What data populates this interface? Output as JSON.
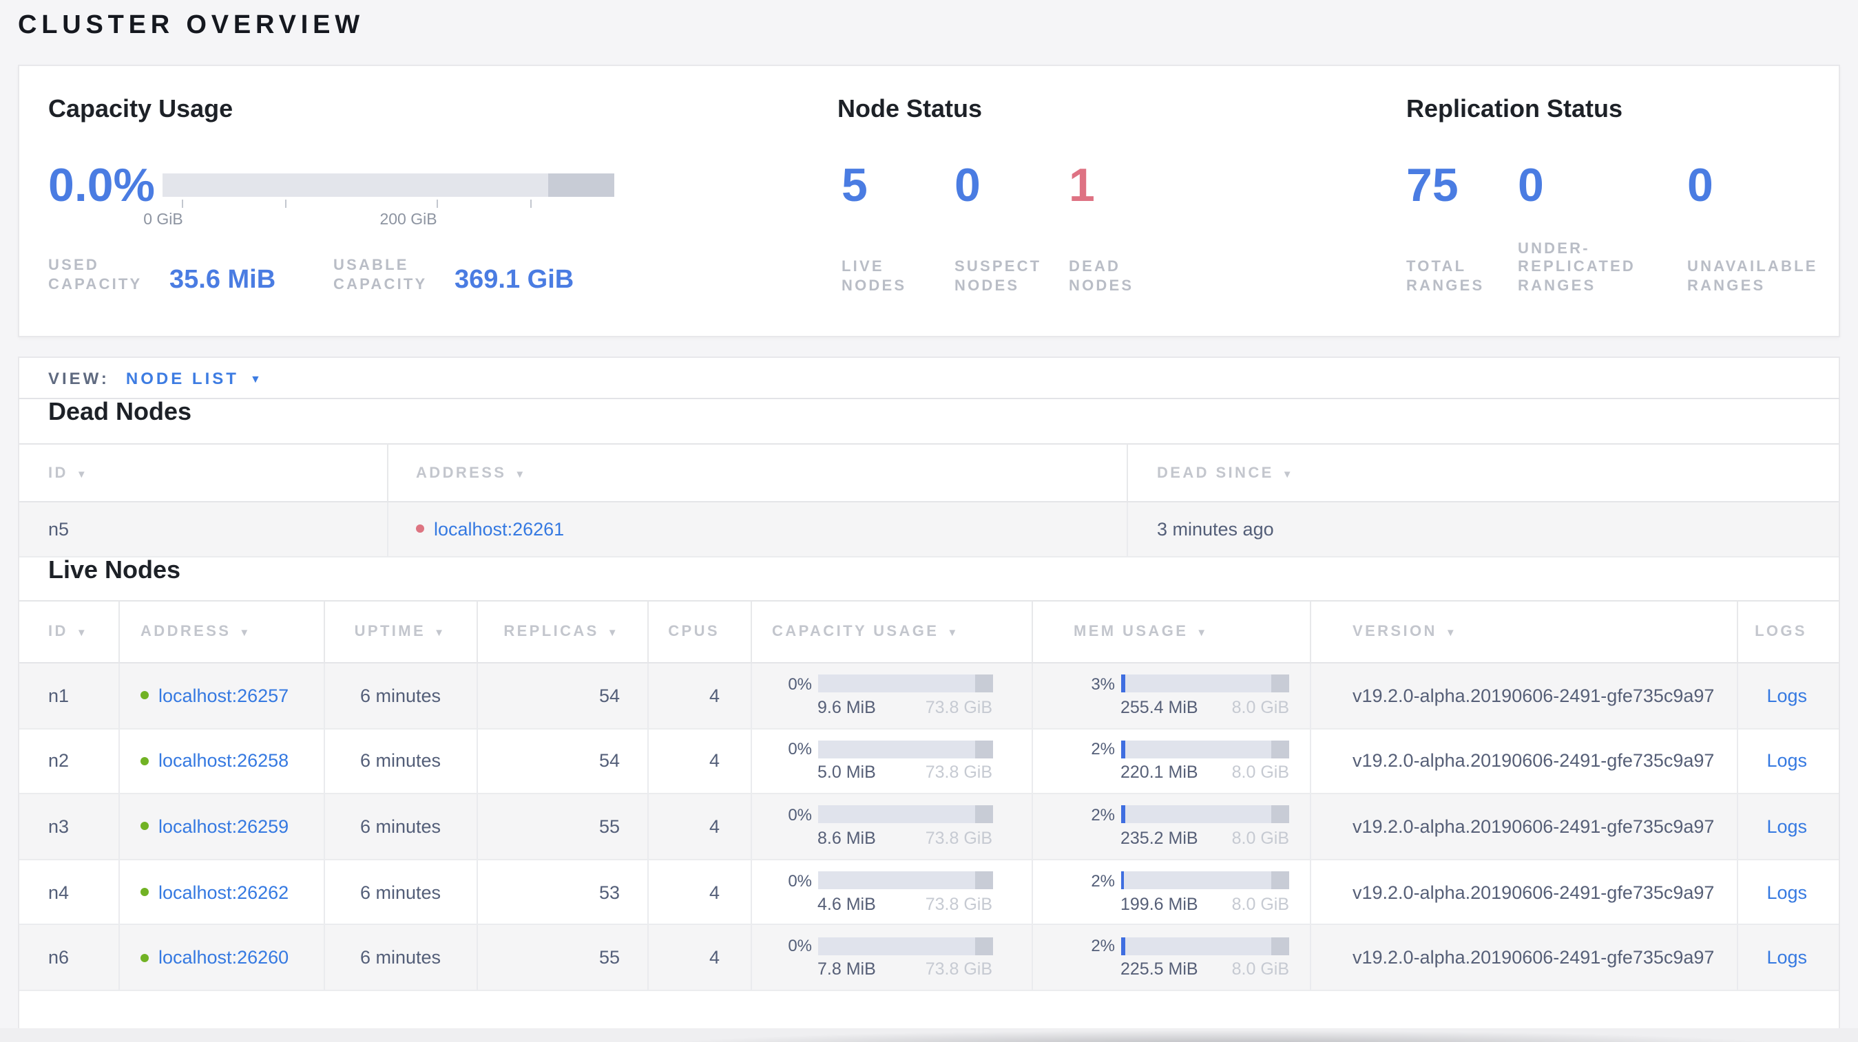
{
  "page": {
    "title": "CLUSTER OVERVIEW"
  },
  "icons": {
    "sort_arrow": "▼",
    "dropdown_arrow": "▼"
  },
  "colors": {
    "accent_blue": "#4a7ce2",
    "link_blue": "#3579e1",
    "dead_red": "#de7283",
    "live_green": "#71b224",
    "bar_track": "#e0e3ec",
    "bar_used_blue": "#3f6ee0",
    "bar_other_gray": "#c8ccd6"
  },
  "summary": {
    "capacity": {
      "title": "Capacity Usage",
      "percent": "0.0%",
      "fill_pct": 0,
      "ticks": [
        {
          "label": "0 GiB"
        },
        {
          "label": ""
        },
        {
          "label": "200 GiB"
        },
        {
          "label": ""
        }
      ],
      "used": {
        "label": "USED CAPACITY",
        "value": "35.6 MiB"
      },
      "usable": {
        "label": "USABLE CAPACITY",
        "value": "369.1 GiB"
      }
    },
    "node_status": {
      "title": "Node Status",
      "stats": [
        {
          "value": "5",
          "label": "LIVE NODES",
          "state": "live"
        },
        {
          "value": "0",
          "label": "SUSPECT NODES",
          "state": "suspect"
        },
        {
          "value": "1",
          "label": "DEAD NODES",
          "state": "dead"
        }
      ]
    },
    "replication": {
      "title": "Replication Status",
      "stats": [
        {
          "value": "75",
          "label": "TOTAL RANGES"
        },
        {
          "value": "0",
          "label": "UNDER-REPLICATED RANGES"
        },
        {
          "value": "0",
          "label": "UNAVAILABLE RANGES"
        }
      ]
    }
  },
  "view_bar": {
    "label": "VIEW:",
    "selected": "NODE LIST"
  },
  "dead_nodes": {
    "heading": "Dead Nodes",
    "columns": [
      {
        "label": "ID",
        "sortable": true
      },
      {
        "label": "ADDRESS",
        "sortable": true
      },
      {
        "label": "DEAD SINCE",
        "sortable": true
      }
    ],
    "rows": [
      {
        "id": "n5",
        "address": "localhost:26261",
        "dead_since": "3 minutes ago"
      }
    ]
  },
  "live_nodes": {
    "heading": "Live Nodes",
    "columns": [
      {
        "label": "ID",
        "sortable": true
      },
      {
        "label": "ADDRESS",
        "sortable": true
      },
      {
        "label": "UPTIME",
        "sortable": true
      },
      {
        "label": "REPLICAS",
        "sortable": true
      },
      {
        "label": "CPUS",
        "sortable": false
      },
      {
        "label": "CAPACITY USAGE",
        "sortable": true
      },
      {
        "label": "MEM USAGE",
        "sortable": true
      },
      {
        "label": "VERSION",
        "sortable": true
      },
      {
        "label": "LOGS",
        "sortable": false
      }
    ],
    "rows": [
      {
        "id": "n1",
        "address": "localhost:26257",
        "uptime": "6 minutes",
        "replicas": "54",
        "cpus": "4",
        "capacity": {
          "percent": "0%",
          "fill_pct": 0,
          "used": "9.6 MiB",
          "total": "73.8 GiB"
        },
        "memory": {
          "percent": "3%",
          "fill_pct": 3,
          "used": "255.4 MiB",
          "total": "8.0 GiB"
        },
        "version": "v19.2.0-alpha.20190606-2491-gfe735c9a97",
        "logs_label": "Logs"
      },
      {
        "id": "n2",
        "address": "localhost:26258",
        "uptime": "6 minutes",
        "replicas": "54",
        "cpus": "4",
        "capacity": {
          "percent": "0%",
          "fill_pct": 0,
          "used": "5.0 MiB",
          "total": "73.8 GiB"
        },
        "memory": {
          "percent": "2%",
          "fill_pct": 2.7,
          "used": "220.1 MiB",
          "total": "8.0 GiB"
        },
        "version": "v19.2.0-alpha.20190606-2491-gfe735c9a97",
        "logs_label": "Logs"
      },
      {
        "id": "n3",
        "address": "localhost:26259",
        "uptime": "6 minutes",
        "replicas": "55",
        "cpus": "4",
        "capacity": {
          "percent": "0%",
          "fill_pct": 0,
          "used": "8.6 MiB",
          "total": "73.8 GiB"
        },
        "memory": {
          "percent": "2%",
          "fill_pct": 2.9,
          "used": "235.2 MiB",
          "total": "8.0 GiB"
        },
        "version": "v19.2.0-alpha.20190606-2491-gfe735c9a97",
        "logs_label": "Logs"
      },
      {
        "id": "n4",
        "address": "localhost:26262",
        "uptime": "6 minutes",
        "replicas": "53",
        "cpus": "4",
        "capacity": {
          "percent": "0%",
          "fill_pct": 0,
          "used": "4.6 MiB",
          "total": "73.8 GiB"
        },
        "memory": {
          "percent": "2%",
          "fill_pct": 2.4,
          "used": "199.6 MiB",
          "total": "8.0 GiB"
        },
        "version": "v19.2.0-alpha.20190606-2491-gfe735c9a97",
        "logs_label": "Logs"
      },
      {
        "id": "n6",
        "address": "localhost:26260",
        "uptime": "6 minutes",
        "replicas": "55",
        "cpus": "4",
        "capacity": {
          "percent": "0%",
          "fill_pct": 0,
          "used": "7.8 MiB",
          "total": "73.8 GiB"
        },
        "memory": {
          "percent": "2%",
          "fill_pct": 2.8,
          "used": "225.5 MiB",
          "total": "8.0 GiB"
        },
        "version": "v19.2.0-alpha.20190606-2491-gfe735c9a97",
        "logs_label": "Logs"
      }
    ]
  }
}
